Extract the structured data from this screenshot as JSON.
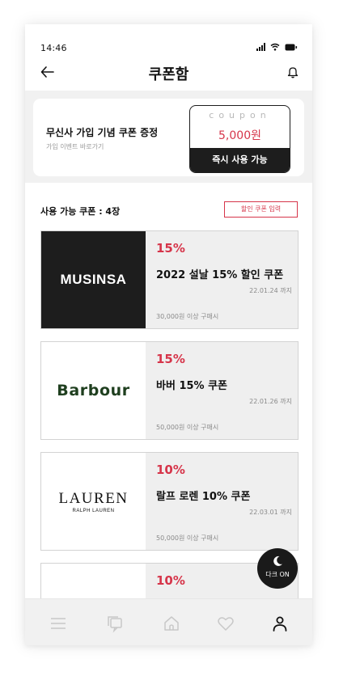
{
  "status_bar": {
    "time": "14:46"
  },
  "header": {
    "title": "쿠폰함"
  },
  "welcome": {
    "title": "무신사 가입 기념 쿠폰 증정",
    "subtitle": "가입 이벤트 바로가기",
    "ticket_word": "coupon",
    "amount": "5,000원",
    "use_label": "즉시 사용 가능"
  },
  "list": {
    "count_label": "사용 가능 쿠폰 : 4장",
    "code_button": "할인 쿠폰 입력"
  },
  "coupons": [
    {
      "brand": "MUSINSA",
      "rate": "15%",
      "name": "2022 설날 15% 할인 쿠폰",
      "expiry": "22.01.24 까지",
      "min": "30,000원 이상 구매시"
    },
    {
      "brand": "Barbour",
      "rate": "15%",
      "name": "바버 15% 쿠폰",
      "expiry": "22.01.26 까지",
      "min": "50,000원 이상 구매시"
    },
    {
      "brand": "LAUREN",
      "brand_sub": "RALPH LAUREN",
      "rate": "10%",
      "name": "랄프 로렌 10% 쿠폰",
      "expiry": "22.03.01 까지",
      "min": "50,000원 이상 구매시"
    },
    {
      "rate": "10%"
    }
  ],
  "dark_mode": {
    "label": "다크 ON"
  },
  "nav": {
    "items": [
      "menu-icon",
      "chat-icon",
      "home-icon",
      "heart-icon",
      "user-icon"
    ],
    "active": "user-icon"
  },
  "colors": {
    "accent": "#d6354a",
    "dark": "#1d1d1d",
    "barbour_green": "#1f3f1f",
    "background": "#f1f1f1"
  }
}
